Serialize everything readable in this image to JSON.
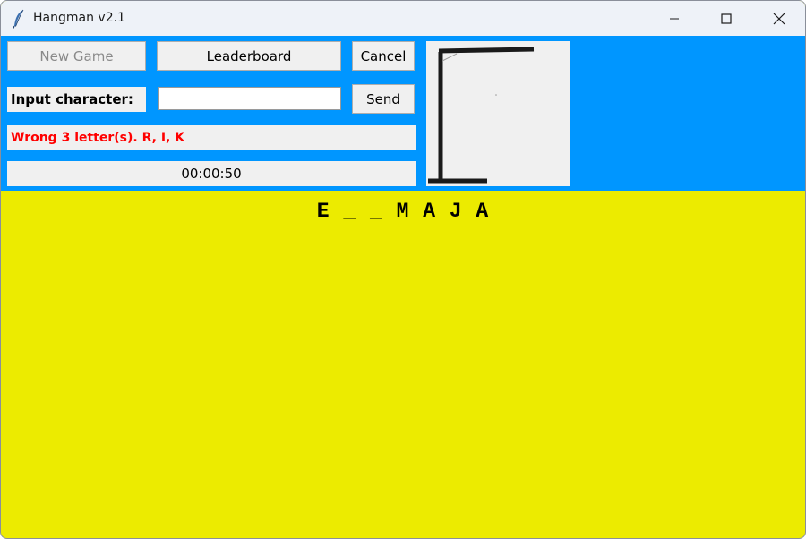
{
  "window": {
    "title": "Hangman v2.1",
    "icon": "feather-icon"
  },
  "controls": {
    "new_game_label": "New Game",
    "leaderboard_label": "Leaderboard",
    "cancel_label": "Cancel",
    "input_label": "Input character:",
    "input_value": "",
    "send_label": "Send"
  },
  "status": {
    "wrong_letters_text": "Wrong 3 letter(s). R, I, K",
    "timer": "00:00:50"
  },
  "game": {
    "word_display": "E _ _ M A J A",
    "wrong_count": 3
  },
  "colors": {
    "top_panel": "#0096ff",
    "board_bg": "#eceb00",
    "error_text": "#ff0000"
  }
}
